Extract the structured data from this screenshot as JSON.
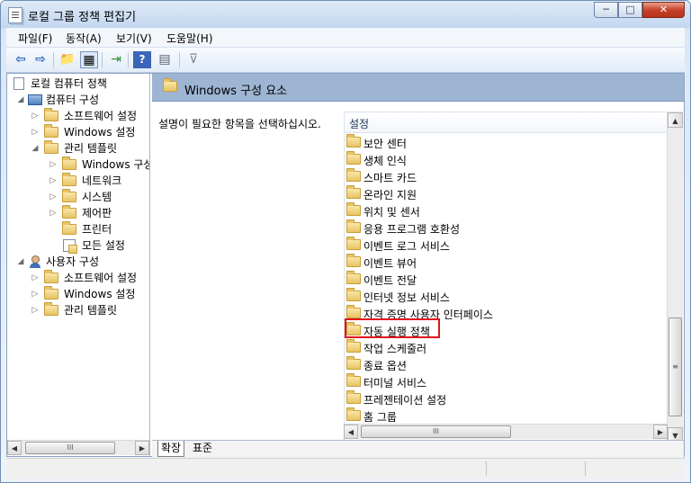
{
  "window": {
    "title": "로컬 그룹 정책 편집기"
  },
  "window_controls": {
    "minimize": "─",
    "maximize": "□",
    "close": "✕"
  },
  "menu": [
    "파일(F)",
    "동작(A)",
    "보기(V)",
    "도움말(H)"
  ],
  "toolbar": {
    "back": "⇦",
    "forward": "⇨",
    "up": "📁",
    "showhide": "▦",
    "export": "⇥",
    "help": "?",
    "properties": "▤",
    "filter": "⊽"
  },
  "tree": {
    "root": "로컬 컴퓨터 정책",
    "computer": "컴퓨터 구성",
    "computer_children": [
      "소프트웨어 설정",
      "Windows 설정",
      "관리 템플릿"
    ],
    "admin_children": [
      "Windows 구성 요소",
      "네트워크",
      "시스템",
      "제어판",
      "프린터",
      "모든 설정"
    ],
    "user": "사용자 구성",
    "user_children": [
      "소프트웨어 설정",
      "Windows 설정",
      "관리 템플릿"
    ]
  },
  "header": {
    "title": "Windows 구성 요소"
  },
  "description": "설명이 필요한 항목을 선택하십시오.",
  "settings": {
    "column": "설정",
    "items": [
      "보안 센터",
      "생체 인식",
      "스마트 카드",
      "온라인 지원",
      "위치 및 센서",
      "응용 프로그램 호환성",
      "이벤트 로그 서비스",
      "이벤트 뷰어",
      "이벤트 전달",
      "인터넷 정보 서비스",
      "자격 증명 사용자 인터페이스",
      "자동 실행 정책",
      "작업 스케줄러",
      "종료 옵션",
      "터미널 서비스",
      "프레젠테이션 설정",
      "홈 그룹"
    ]
  },
  "tabs": [
    "확장",
    "표준"
  ],
  "scroll": {
    "left": "◀",
    "right": "▶",
    "up": "▲",
    "down": "▼",
    "grip": "III",
    "grip_v": "≡"
  }
}
